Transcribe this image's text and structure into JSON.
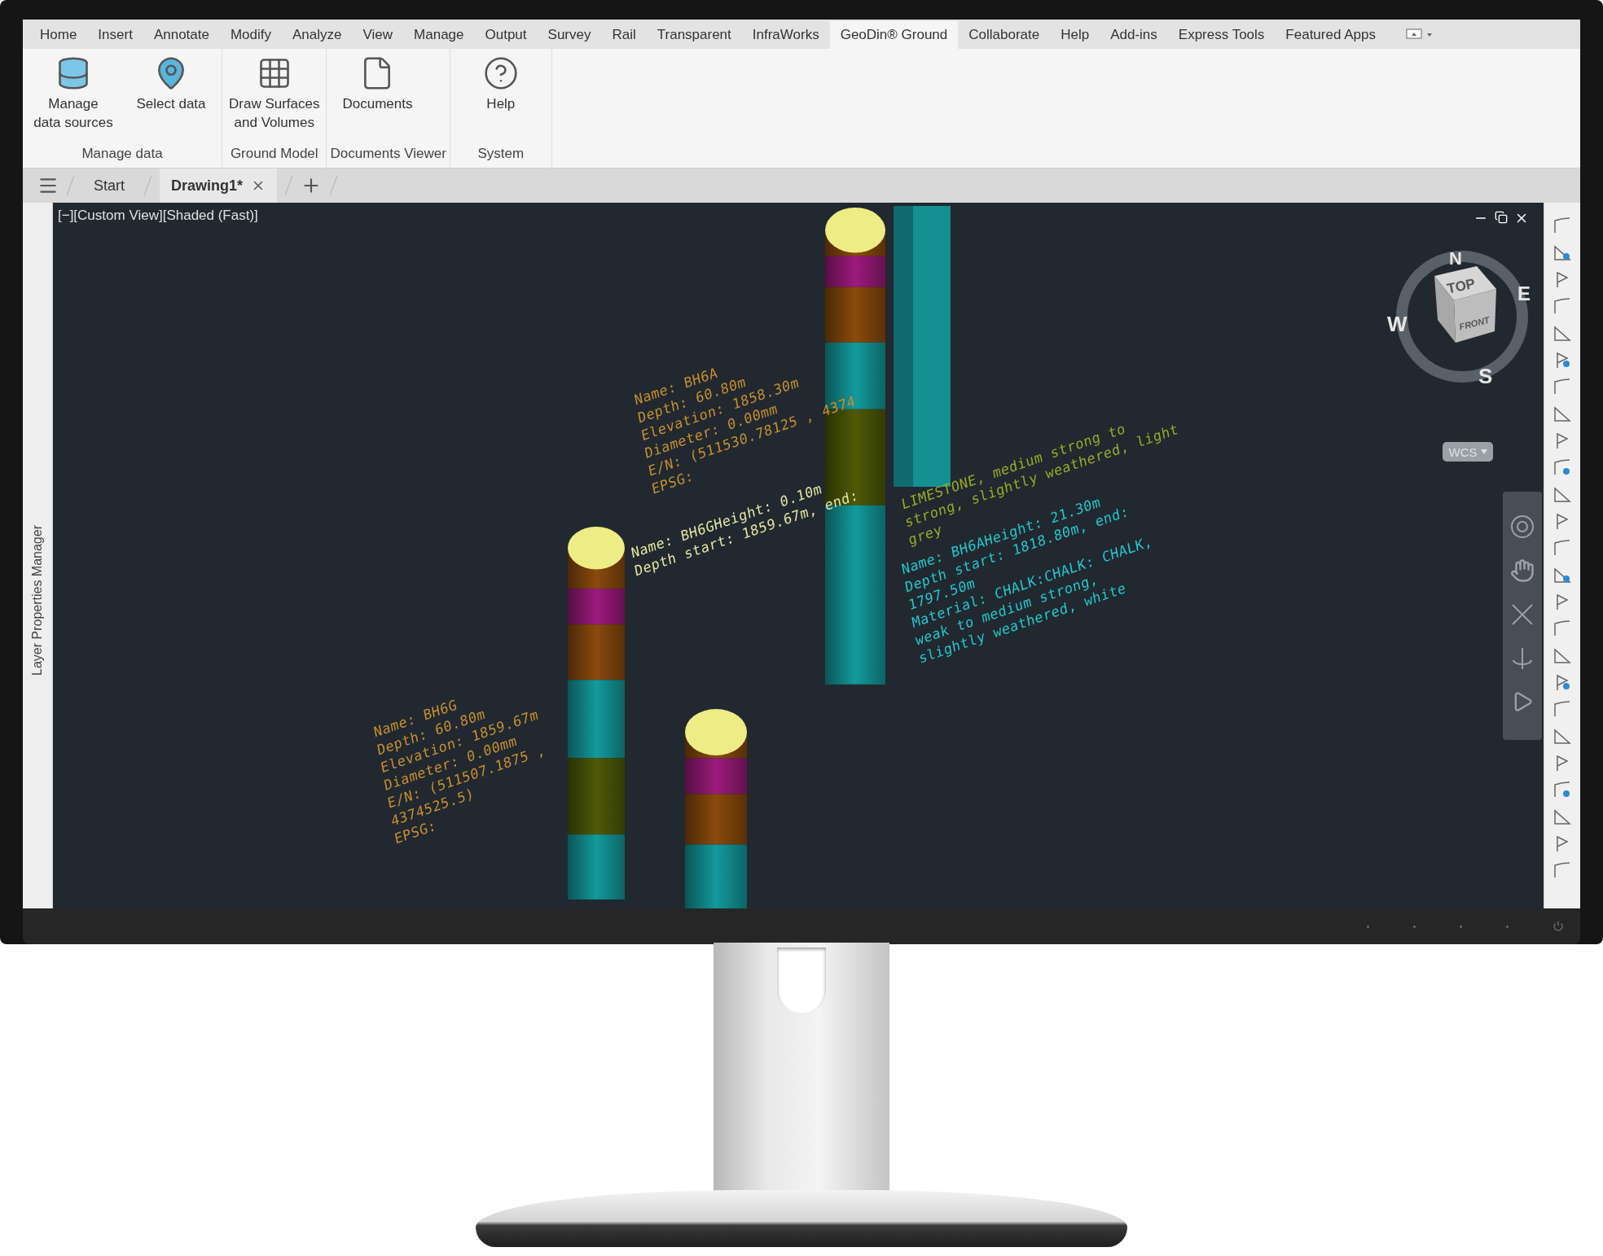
{
  "ribbon_tabs": [
    {
      "label": "Home",
      "selected": false
    },
    {
      "label": "Insert",
      "selected": false
    },
    {
      "label": "Annotate",
      "selected": false
    },
    {
      "label": "Modify",
      "selected": false
    },
    {
      "label": "Analyze",
      "selected": false
    },
    {
      "label": "View",
      "selected": false
    },
    {
      "label": "Manage",
      "selected": false
    },
    {
      "label": "Output",
      "selected": false
    },
    {
      "label": "Survey",
      "selected": false
    },
    {
      "label": "Rail",
      "selected": false
    },
    {
      "label": "Transparent",
      "selected": false
    },
    {
      "label": "InfraWorks",
      "selected": false
    },
    {
      "label": "GeoDin® Ground",
      "selected": true
    },
    {
      "label": "Collaborate",
      "selected": false
    },
    {
      "label": "Help",
      "selected": false
    },
    {
      "label": "Add-ins",
      "selected": false
    },
    {
      "label": "Express Tools",
      "selected": false
    },
    {
      "label": "Featured Apps",
      "selected": false
    }
  ],
  "ribbon_groups": [
    {
      "label": "Manage data",
      "buttons": [
        {
          "label": "Manage\ndata sources",
          "kind": "database"
        },
        {
          "label": "Select data",
          "kind": "map"
        }
      ]
    },
    {
      "label": "Ground Model",
      "buttons": [
        {
          "label": "Draw Surfaces\nand Volumes",
          "kind": "grid"
        }
      ]
    },
    {
      "label": "Documents Viewer",
      "buttons": [
        {
          "label": "Documents",
          "kind": "document"
        }
      ]
    },
    {
      "label": "System",
      "buttons": [
        {
          "label": "Help",
          "kind": "help"
        }
      ]
    }
  ],
  "document_tabs": [
    {
      "label": "Start",
      "selected": false,
      "closable": false
    },
    {
      "label": "Drawing1*",
      "selected": true,
      "closable": true
    }
  ],
  "side_panel": {
    "title": "Layer Properties Manager"
  },
  "viewport": {
    "label": "[−][Custom View][Shaded (Fast)]",
    "view_cube": {
      "top": "TOP",
      "front": "FRONT",
      "north": "N",
      "east": "E",
      "south": "S",
      "west": "W"
    },
    "coordinate_system": "WCS",
    "annotations": [
      {
        "color": "#c8902c",
        "lines": [
          "Name:  BH6A",
          "Depth:  60.80m",
          "Elevation:  1858.30m",
          "Diameter:  0.00mm",
          "E/N:  (511530.78125 , 4374",
          "EPSG:"
        ]
      },
      {
        "color": "#c8902c",
        "lines": [
          "Name:  BH6G",
          "Depth:  60.80m",
          "Elevation:  1859.67m",
          "Diameter:  0.00mm",
          "E/N:  (511507.1875 ,",
          "4374525.5)",
          "EPSG:"
        ]
      },
      {
        "color": "#e6e6a0",
        "lines": [
          "Name:  BH6GHeight:  0.10m",
          "Depth start:  1859.67m, end:"
        ]
      },
      {
        "color": "#9aaa22",
        "lines": [
          "LIMESTONE, medium strong to",
          "strong, slightly weathered, light",
          "grey"
        ]
      },
      {
        "color": "#22c8cc",
        "lines": [
          "Name:  BH6AHeight:  21.30m",
          "Depth start:  1818.80m, end:",
          "1797.50m",
          "Material:  CHALK:CHALK:  CHALK,",
          "weak to medium strong,",
          "slightly weathered, white"
        ]
      }
    ]
  }
}
